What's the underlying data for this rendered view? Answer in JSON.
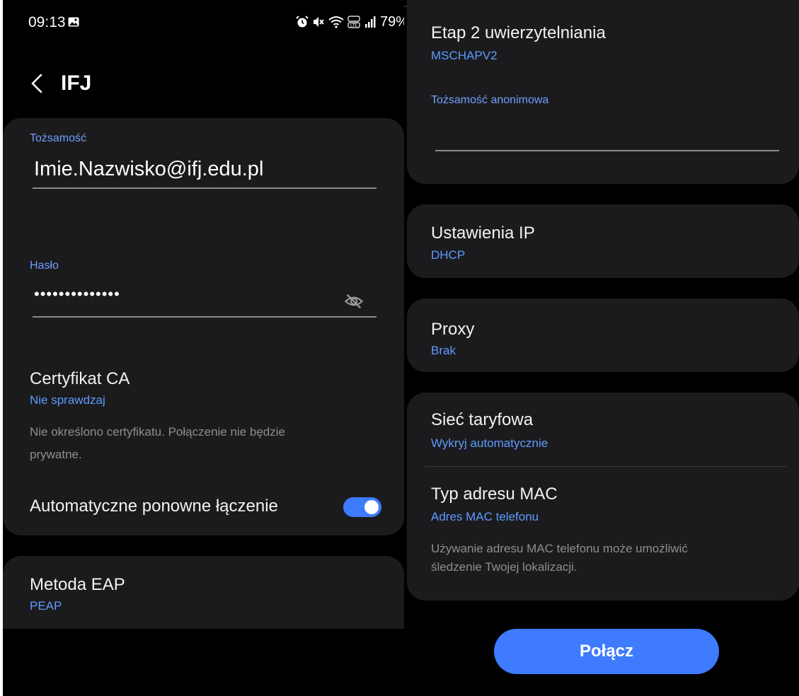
{
  "status_bar": {
    "time": "09:13",
    "battery": "79%",
    "network": "LTE"
  },
  "app_bar": {
    "title": "IFJ"
  },
  "identity": {
    "caption": "Tożsamość",
    "value": "Imie.Nazwisko@ifj.edu.pl"
  },
  "password": {
    "caption": "Hasło",
    "value": "••••••••••••••"
  },
  "ca_cert": {
    "label": "Certyfikat CA",
    "value": "Nie sprawdzaj",
    "desc_line1": "Nie określono certyfikatu. Połączenie nie będzie",
    "desc_line2": "prywatne."
  },
  "auto_reconnect": {
    "label": "Automatyczne ponowne łączenie",
    "enabled": true
  },
  "eap": {
    "label": "Metoda EAP",
    "value": "PEAP"
  },
  "phase2": {
    "label": "Etap 2 uwierzytelniania",
    "value": "MSCHAPV2"
  },
  "anon_identity": {
    "caption": "Tożsamość anonimowa",
    "value": ""
  },
  "ip_settings": {
    "label": "Ustawienia IP",
    "value": "DHCP"
  },
  "proxy": {
    "label": "Proxy",
    "value": "Brak"
  },
  "metered": {
    "label": "Sieć taryfowa",
    "value": "Wykryj automatycznie"
  },
  "mac": {
    "label": "Typ adresu MAC",
    "value": "Adres MAC telefonu",
    "desc_line1": "Używanie adresu MAC telefonu może umożliwić",
    "desc_line2": "śledzenie Twojej lokalizacji."
  },
  "connect_button": {
    "label": "Połącz"
  },
  "colors": {
    "accent": "#3e7bff",
    "card": "#1b1b1d",
    "background": "#000000",
    "caption": "#6f9fff"
  }
}
